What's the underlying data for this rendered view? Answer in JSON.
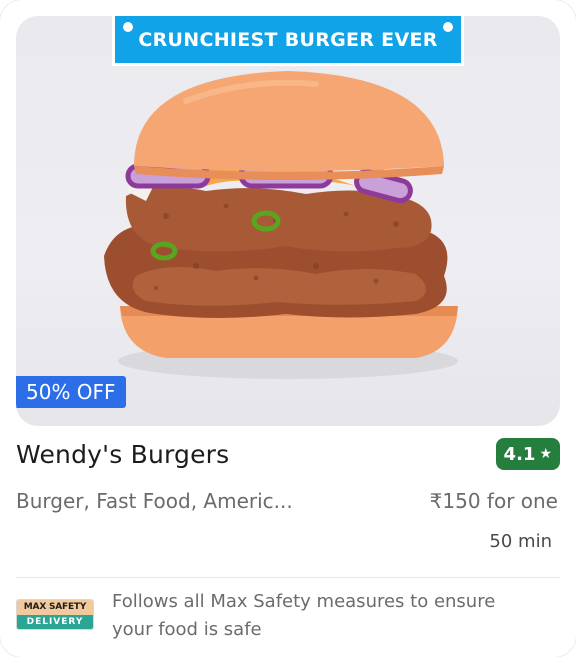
{
  "restaurant": {
    "name": "Wendy's Burgers",
    "rating": "4.1",
    "rating_color": "#267e3e",
    "cuisines": "Burger, Fast Food, Americ...",
    "price": "₹150 for one",
    "delivery_time": "50 min"
  },
  "image": {
    "promo_banner": "CRUNCHIEST BURGER EVER",
    "promo_color": "#11a3e8",
    "offer": "50% OFF",
    "offer_color": "#2b6ee8"
  },
  "safety": {
    "logo_top": "MAX SAFETY",
    "logo_bottom": "DELIVERY",
    "message": "Follows all Max Safety measures to ensure your food is safe"
  },
  "icons": {
    "rating_star": "star-icon"
  }
}
